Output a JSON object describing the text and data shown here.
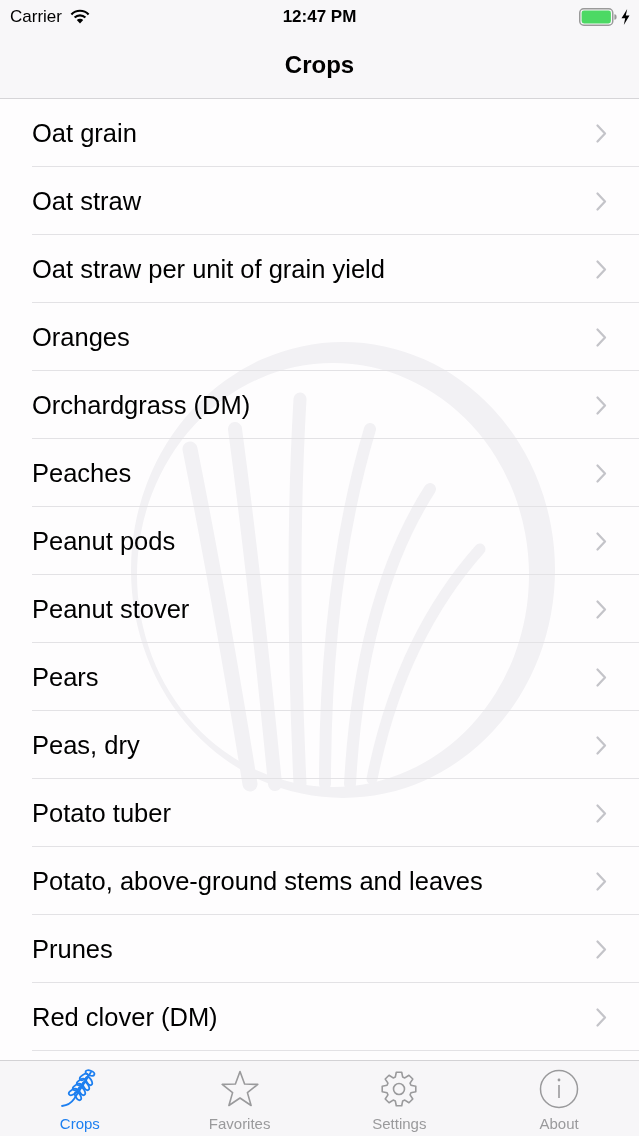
{
  "status_bar": {
    "carrier": "Carrier",
    "time": "12:47 PM"
  },
  "nav_bar": {
    "title": "Crops"
  },
  "list": {
    "items": [
      {
        "label": "Oat grain"
      },
      {
        "label": "Oat straw"
      },
      {
        "label": "Oat straw per unit of grain yield"
      },
      {
        "label": "Oranges"
      },
      {
        "label": "Orchardgrass (DM)"
      },
      {
        "label": "Peaches"
      },
      {
        "label": "Peanut pods"
      },
      {
        "label": "Peanut stover"
      },
      {
        "label": "Pears"
      },
      {
        "label": "Peas, dry"
      },
      {
        "label": "Potato tuber"
      },
      {
        "label": "Potato, above-ground stems and leaves"
      },
      {
        "label": "Prunes"
      },
      {
        "label": "Red clover (DM)"
      }
    ]
  },
  "tab_bar": {
    "tabs": [
      {
        "label": "Crops",
        "kind": "wheat",
        "selected": true
      },
      {
        "label": "Favorites",
        "kind": "star",
        "selected": false
      },
      {
        "label": "Settings",
        "kind": "gear",
        "selected": false
      },
      {
        "label": "About",
        "kind": "info",
        "selected": false
      }
    ]
  }
}
